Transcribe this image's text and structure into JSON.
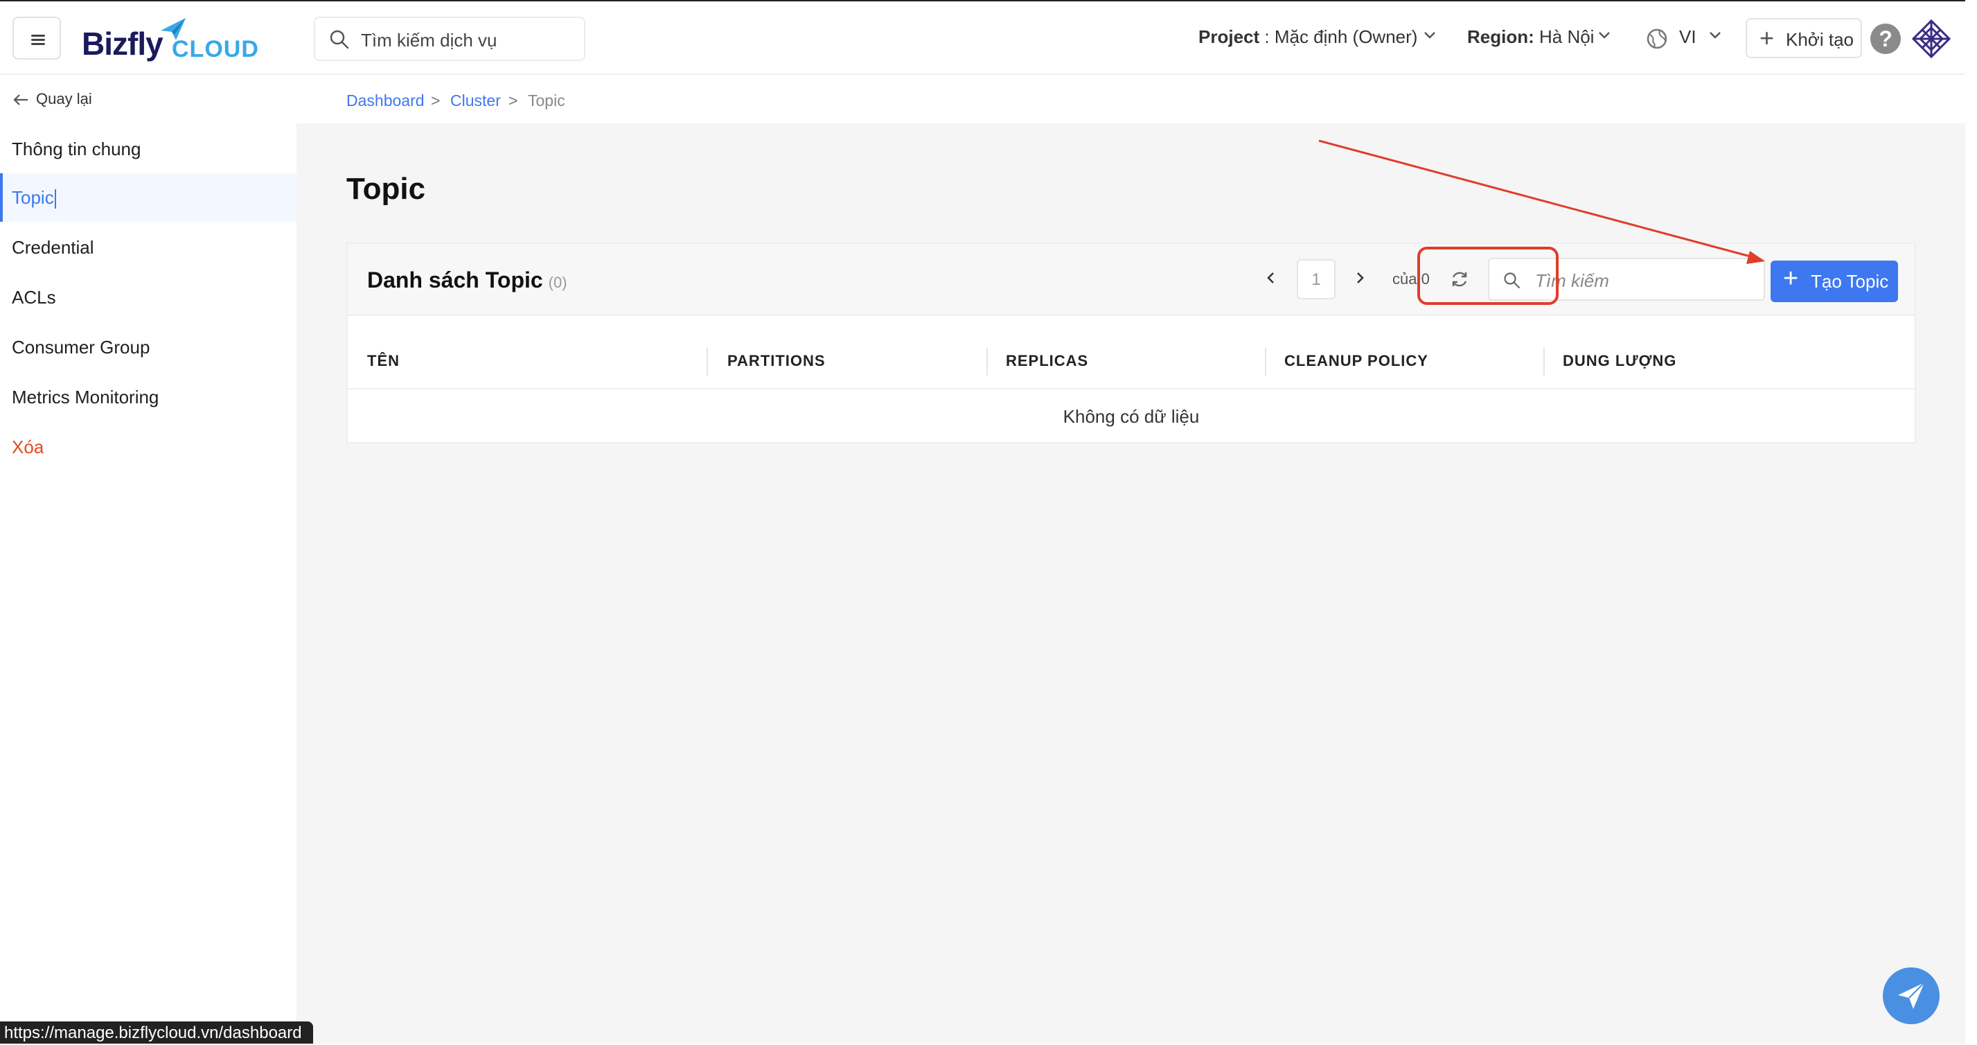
{
  "header": {
    "logo_main": "Bizfly",
    "logo_sub": "CLOUD",
    "search_placeholder": "Tìm kiếm dịch vụ",
    "project_label": "Project",
    "project_value": " : Mặc định (Owner)",
    "region_label": "Region:",
    "region_value": " Hà Nội",
    "language": "VI",
    "create_label": "Khởi tạo",
    "help": "?"
  },
  "sidebar": {
    "back_label": "Quay lại",
    "items": [
      {
        "label": "Thông tin chung"
      },
      {
        "label": "Topic"
      },
      {
        "label": "Credential"
      },
      {
        "label": "ACLs"
      },
      {
        "label": "Consumer Group"
      },
      {
        "label": "Metrics Monitoring"
      },
      {
        "label": "Xóa"
      }
    ]
  },
  "breadcrumb": {
    "items": [
      "Dashboard",
      "Cluster",
      "Topic"
    ],
    "separator": ">"
  },
  "page": {
    "title": "Topic"
  },
  "topic_list": {
    "title": "Danh sách Topic",
    "count": "(0)",
    "page_current": "1",
    "page_of": "của 0",
    "search_placeholder": "Tìm kiếm",
    "create_button": "Tạo Topic",
    "columns": [
      "TÊN",
      "PARTITIONS",
      "REPLICAS",
      "CLEANUP POLICY",
      "DUNG LƯỢNG"
    ],
    "rows": [],
    "empty_text": "Không có dữ liệu"
  },
  "status_bar": {
    "url": "https://manage.bizflycloud.vn/dashboard"
  },
  "colors": {
    "primary": "#3d78f0",
    "danger": "#e8461f",
    "annotation": "#e23c2b"
  }
}
